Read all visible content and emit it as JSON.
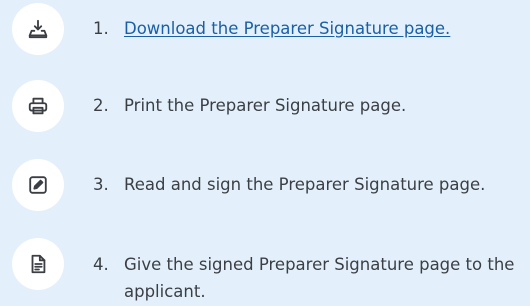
{
  "steps": [
    {
      "number": "1.",
      "text": "Download the Preparer Signature page.",
      "is_link": true,
      "icon": "download-icon"
    },
    {
      "number": "2.",
      "text": "Print the Preparer Signature page.",
      "is_link": false,
      "icon": "printer-icon"
    },
    {
      "number": "3.",
      "text": "Read and sign the Preparer Signature page.",
      "is_link": false,
      "icon": "edit-icon"
    },
    {
      "number": "4.",
      "text": "Give the signed Preparer Signature page to the applicant.",
      "is_link": false,
      "icon": "document-icon"
    }
  ],
  "colors": {
    "background": "#e3f0fb",
    "icon_circle": "#ffffff",
    "text": "#3b3f44",
    "link": "#1a5fa6"
  }
}
